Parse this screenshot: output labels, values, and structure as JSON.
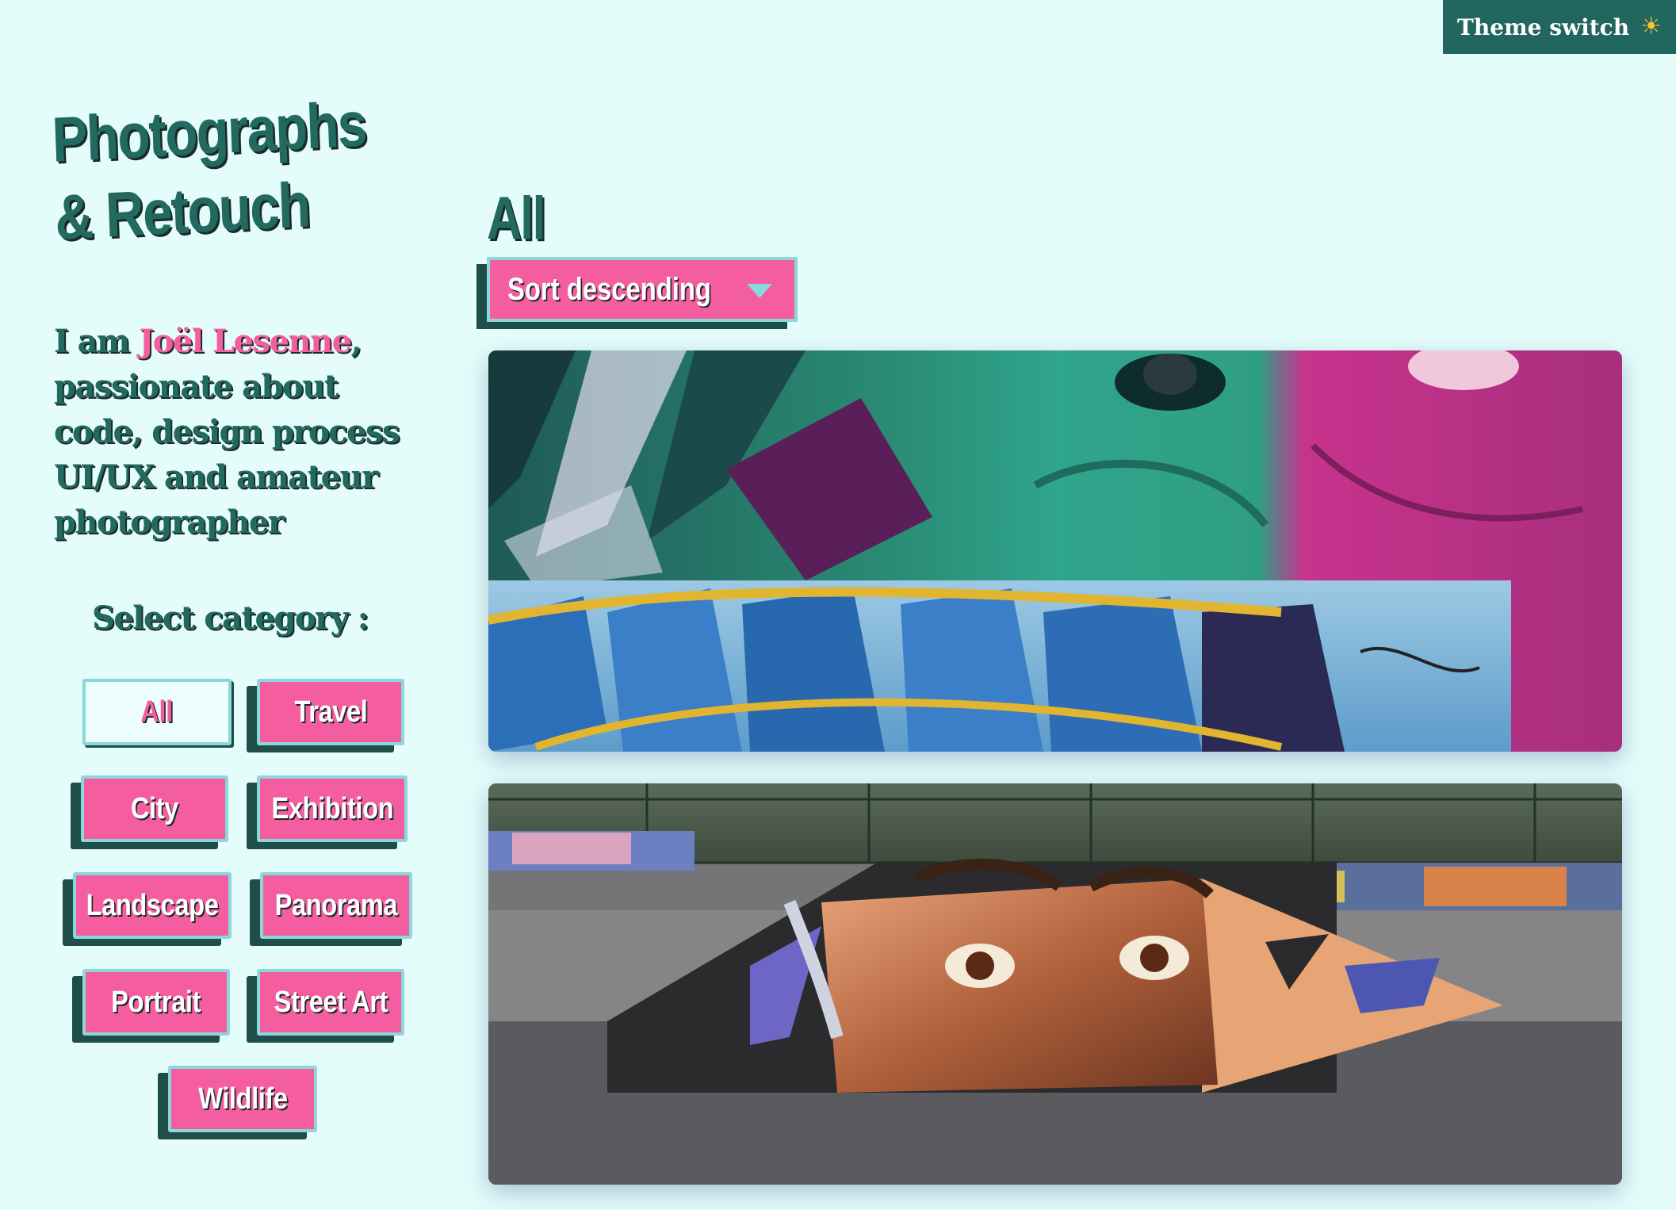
{
  "theme_switch": {
    "label": "Theme switch",
    "icon": "sun-icon",
    "icon_glyph": "☀"
  },
  "brand": {
    "title_line1": "Photographs",
    "title_line2": "& Retouch"
  },
  "intro": {
    "prefix": "I am ",
    "name": "Joël Lesenne",
    "suffix": ", passionate about code, design process UI/UX and amateur photographer"
  },
  "categories": {
    "heading": "Select category :",
    "items": [
      {
        "label": "All",
        "active": true
      },
      {
        "label": "Travel"
      },
      {
        "label": "City"
      },
      {
        "label": "Exhibition"
      },
      {
        "label": "Landscape"
      },
      {
        "label": "Panorama"
      },
      {
        "label": "Portrait"
      },
      {
        "label": "Street Art"
      },
      {
        "label": "Wildlife"
      }
    ]
  },
  "main": {
    "heading": "All",
    "sort": {
      "selected": "Sort descending",
      "icon": "caret-down-icon"
    }
  },
  "gallery": {
    "photos": [
      {
        "subject": "street-art-mural-faces"
      },
      {
        "subject": "skatepark-ramp-mural"
      }
    ]
  },
  "colors": {
    "background": "#e4fdfb",
    "primary_green": "#22695f",
    "accent_pink": "#f45da0",
    "border_cyan": "#8ad8dc",
    "shadow_dark": "#1f4d49",
    "theme_switch_bg": "#20655e"
  }
}
